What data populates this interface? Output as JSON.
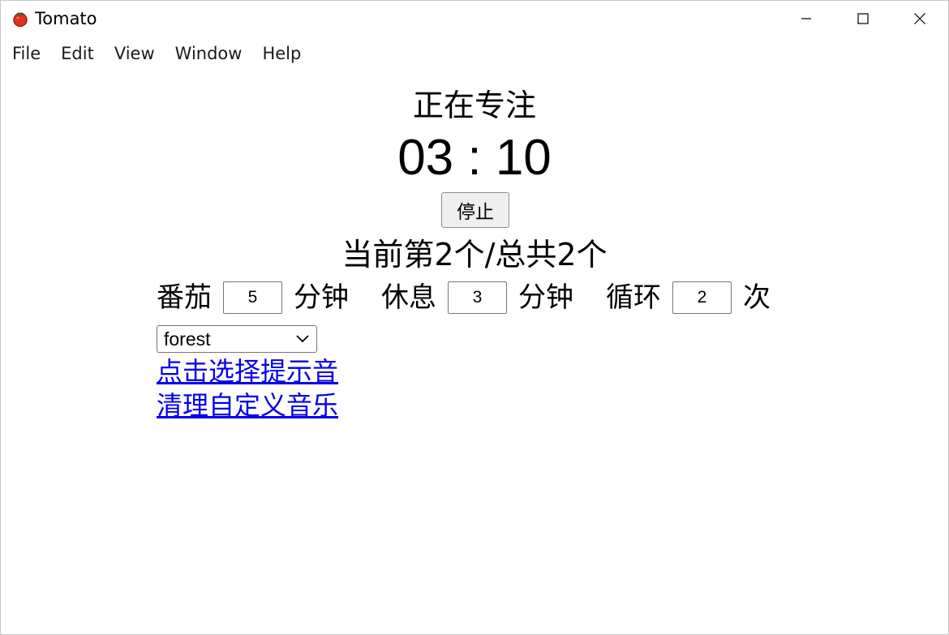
{
  "window": {
    "title": "Tomato",
    "icon": "tomato-icon"
  },
  "menu": [
    "File",
    "Edit",
    "View",
    "Window",
    "Help"
  ],
  "main": {
    "status": "正在专注",
    "timer": "03 : 10",
    "stop_label": "停止",
    "progress": "当前第2个/总共2个",
    "settings": {
      "tomato_label": "番茄",
      "tomato_minutes": "5",
      "minutes_unit_1": "分钟",
      "rest_label": "休息",
      "rest_minutes": "3",
      "minutes_unit_2": "分钟",
      "loop_label": "循环",
      "loop_count": "2",
      "times_unit": "次"
    },
    "sound_select": {
      "value": "forest"
    },
    "links": {
      "choose_sound": "点击选择提示音",
      "clear_music": "清理自定义音乐"
    }
  },
  "colors": {
    "link": "#0000ee",
    "tomato_red": "#e0301e",
    "tomato_leaf": "#3a9a3a"
  }
}
